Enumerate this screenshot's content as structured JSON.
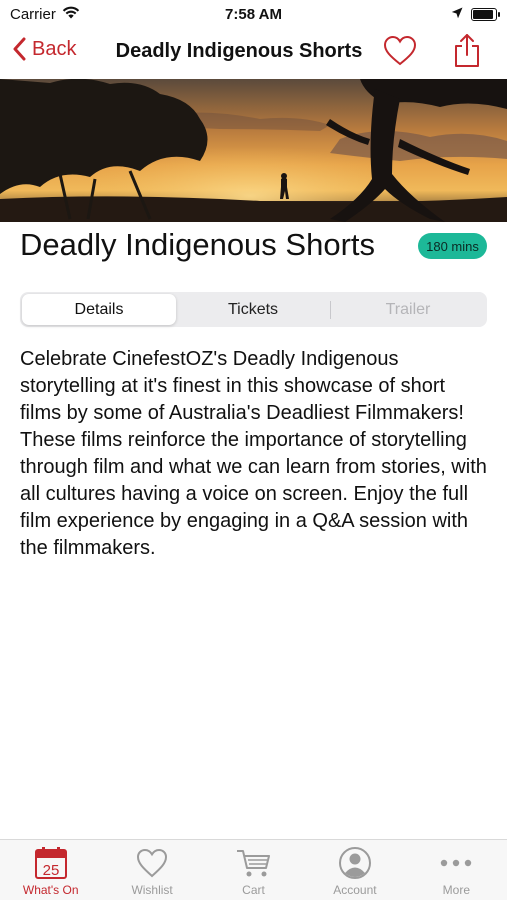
{
  "status_bar": {
    "carrier": "Carrier",
    "time": "7:58 AM",
    "battery_level": 0.9
  },
  "nav": {
    "back_label": "Back",
    "title": "Deadly Indigenous Shorts"
  },
  "film": {
    "title": "Deadly Indigenous Shorts",
    "duration": "180 mins",
    "description": "Celebrate CinefestOZ's Deadly Indigenous storytelling at it's finest in this showcase of short films by some of Australia's Deadliest Filmmakers! These films reinforce the importance of storytelling through film and what we can learn from stories, with all cultures having a voice on screen. Enjoy the full film experience by engaging in a Q&A session with the filmmakers."
  },
  "segments": [
    {
      "label": "Details",
      "state": "selected"
    },
    {
      "label": "Tickets",
      "state": "enabled"
    },
    {
      "label": "Trailer",
      "state": "disabled"
    }
  ],
  "tab_bar": {
    "items": [
      {
        "label": "What's On",
        "icon": "calendar-icon",
        "badge": "25",
        "active": true
      },
      {
        "label": "Wishlist",
        "icon": "heart-icon",
        "active": false
      },
      {
        "label": "Cart",
        "icon": "cart-icon",
        "active": false
      },
      {
        "label": "Account",
        "icon": "account-icon",
        "active": false
      },
      {
        "label": "More",
        "icon": "more-icon",
        "active": false
      }
    ]
  },
  "colors": {
    "accent": "#c4282e",
    "badge": "#1db898",
    "inactive": "#9b9b9b"
  }
}
